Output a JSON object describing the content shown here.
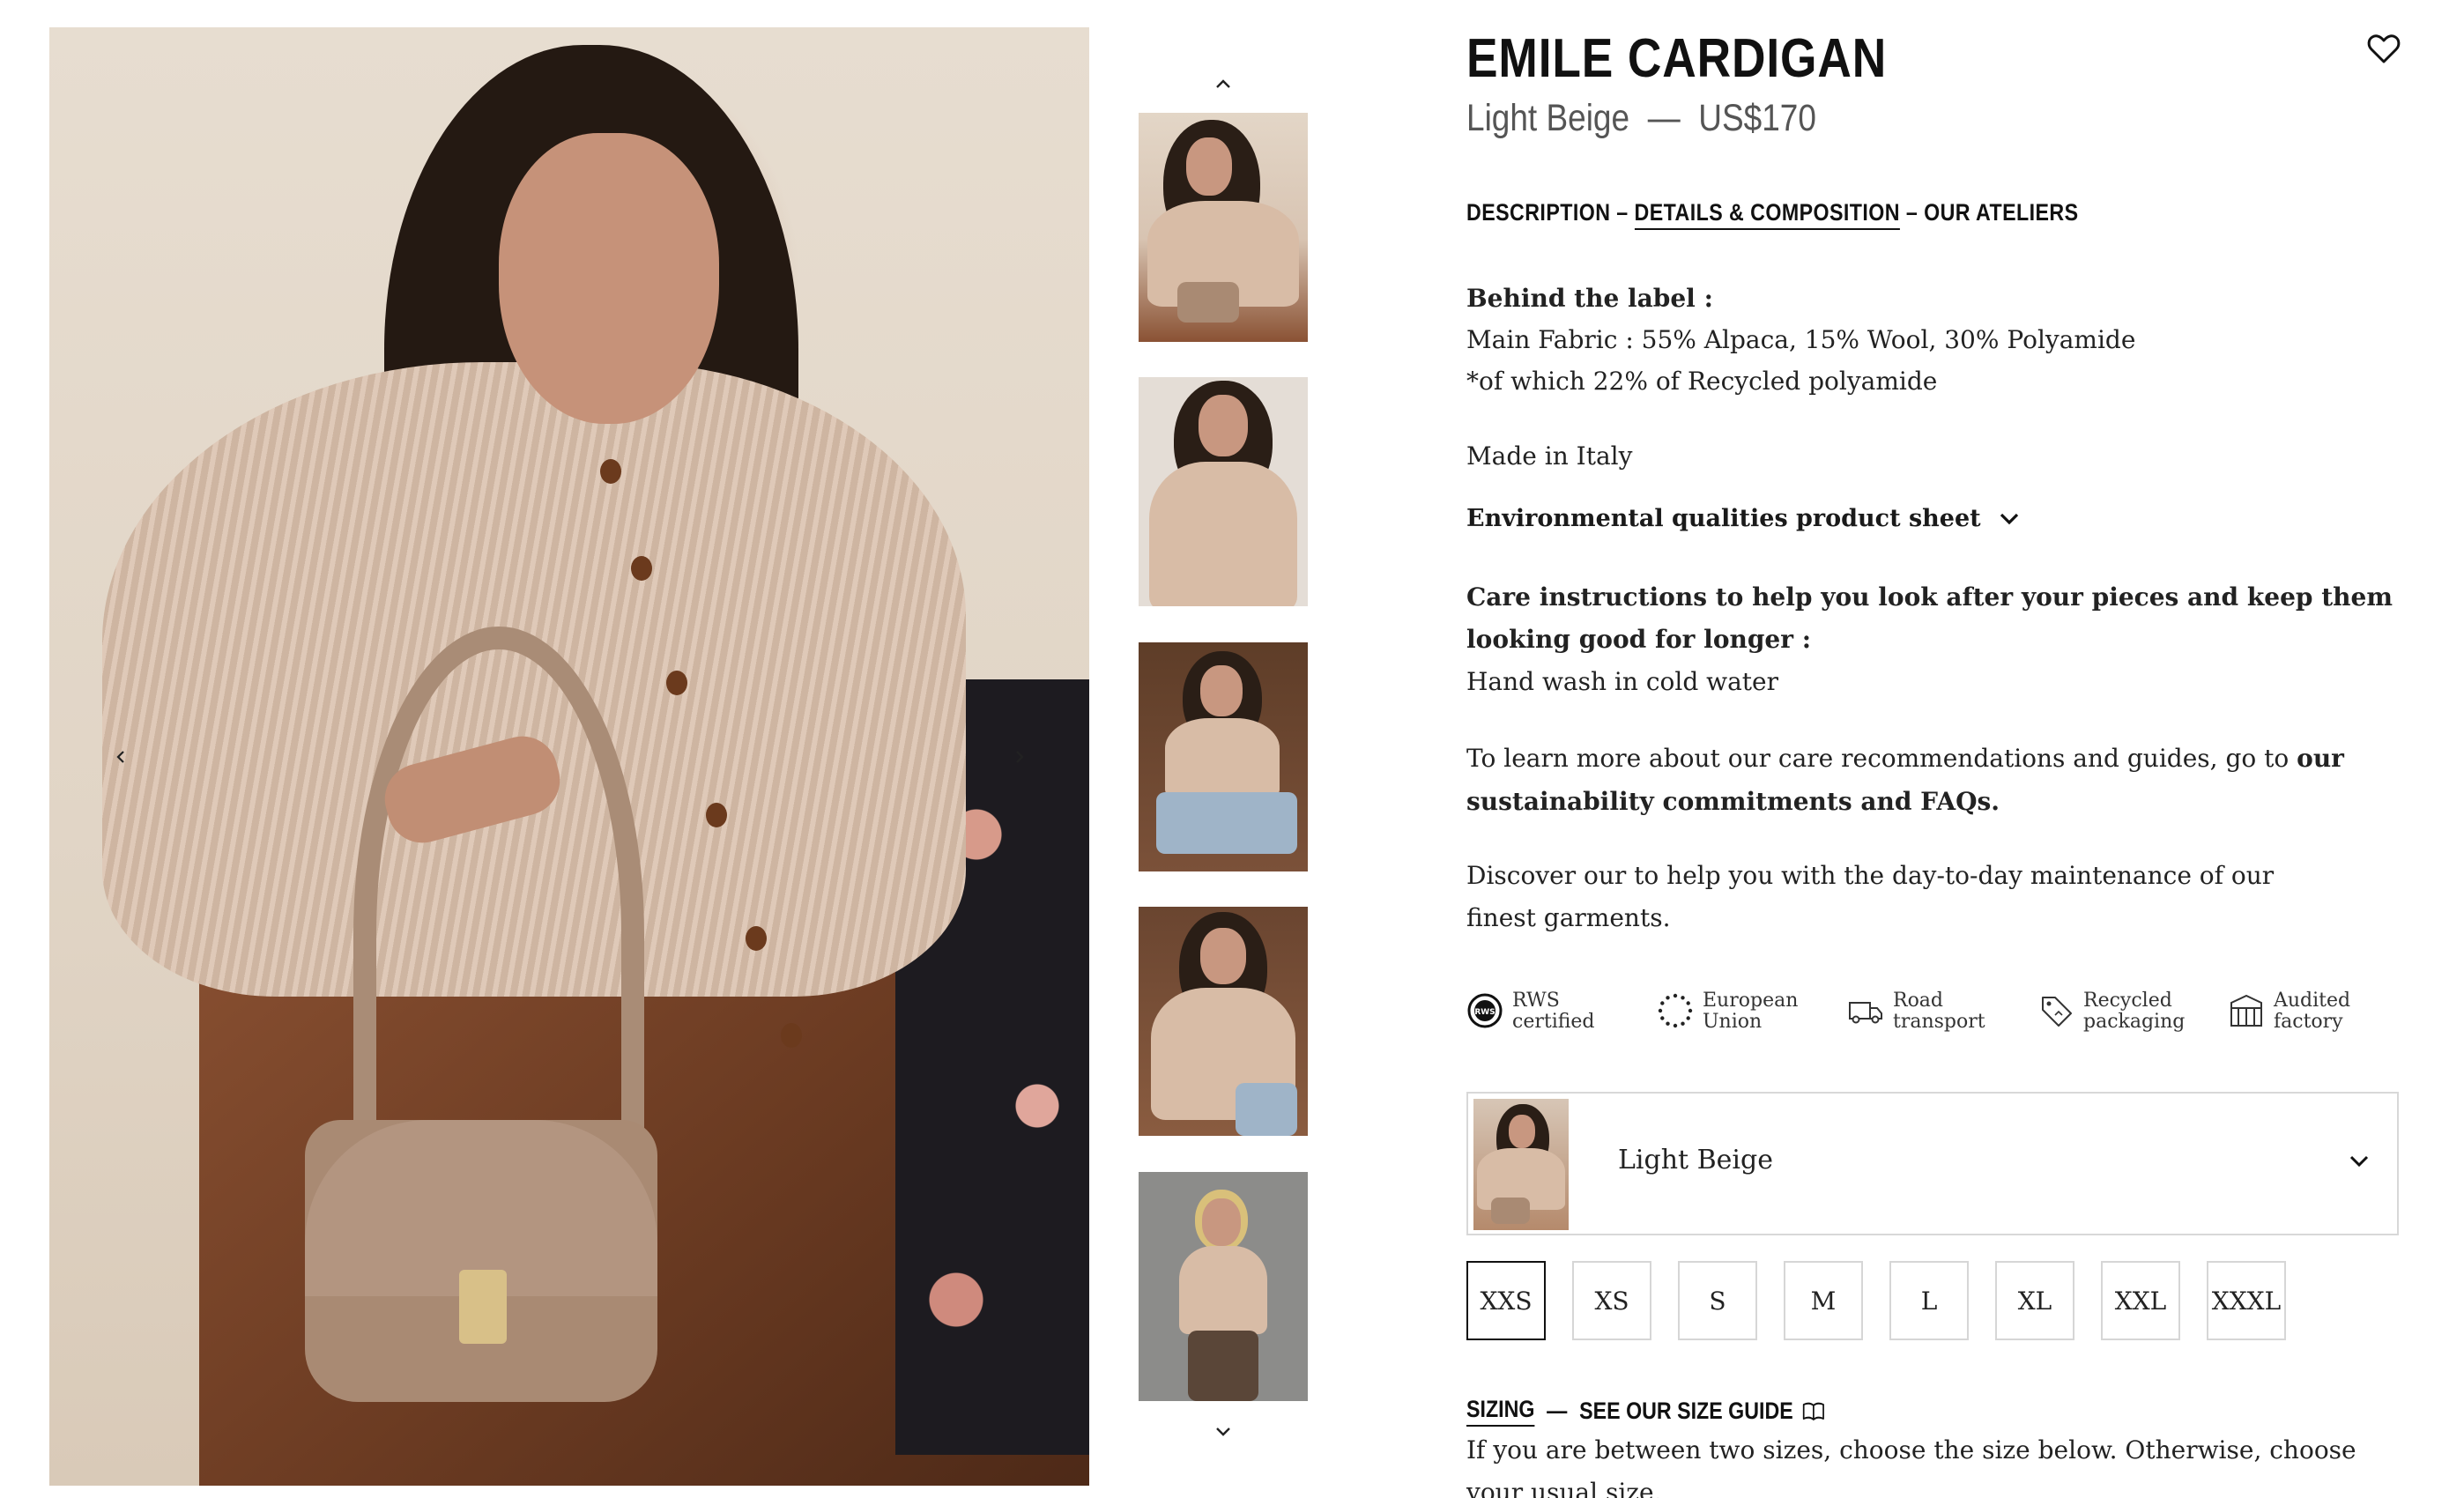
{
  "product": {
    "title": "EMILE CARDIGAN",
    "color_name": "Light Beige",
    "dash": "—",
    "price": "US$170"
  },
  "tabs": [
    {
      "label": "DESCRIPTION",
      "active": false
    },
    {
      "label": "DETAILS & COMPOSITION",
      "active": true
    },
    {
      "label": "OUR ATELIERS",
      "active": false
    }
  ],
  "tab_separator": "–",
  "details": {
    "behind_label_heading": "Behind the label :",
    "main_fabric": "Main Fabric : 55% Alpaca, 15% Wool, 30% Polyamide",
    "recycled_note": "*of which 22% of Recycled polyamide",
    "made_in": "Made in Italy",
    "env_sheet_label": "Environmental qualities product sheet",
    "care_heading": "Care instructions to help you look after your pieces and keep them looking good for longer :",
    "care_text": "Hand wash in cold water",
    "learn_more_text": "To learn more about our care recommendations and guides, go to ",
    "learn_more_link": "our sustainability commitments and FAQs.",
    "discover_text": "Discover our to help you with the day-to-day maintenance of our finest garments."
  },
  "badges": [
    {
      "icon": "rws-icon",
      "label": "RWS certified"
    },
    {
      "icon": "eu-stars-icon",
      "label": "European Union"
    },
    {
      "icon": "truck-icon",
      "label": "Road transport"
    },
    {
      "icon": "recycle-tag-icon",
      "label": "Recycled packaging"
    },
    {
      "icon": "factory-icon",
      "label": "Audited factory"
    }
  ],
  "color_selector": {
    "selected": "Light Beige"
  },
  "sizes": [
    {
      "label": "XXS",
      "selected": true
    },
    {
      "label": "XS",
      "selected": false
    },
    {
      "label": "S",
      "selected": false
    },
    {
      "label": "M",
      "selected": false
    },
    {
      "label": "L",
      "selected": false
    },
    {
      "label": "XL",
      "selected": false
    },
    {
      "label": "XXL",
      "selected": false
    },
    {
      "label": "XXXL",
      "selected": false
    }
  ],
  "sizing": {
    "label": "SIZING",
    "dash": "—",
    "guide_link": "SEE OUR SIZE GUIDE",
    "advice": "If you are between two sizes, choose the size below. Otherwise, choose your usual size."
  },
  "colors": {
    "text": "#1a1a1a",
    "muted": "#555555",
    "border": "#d8d8d8"
  }
}
